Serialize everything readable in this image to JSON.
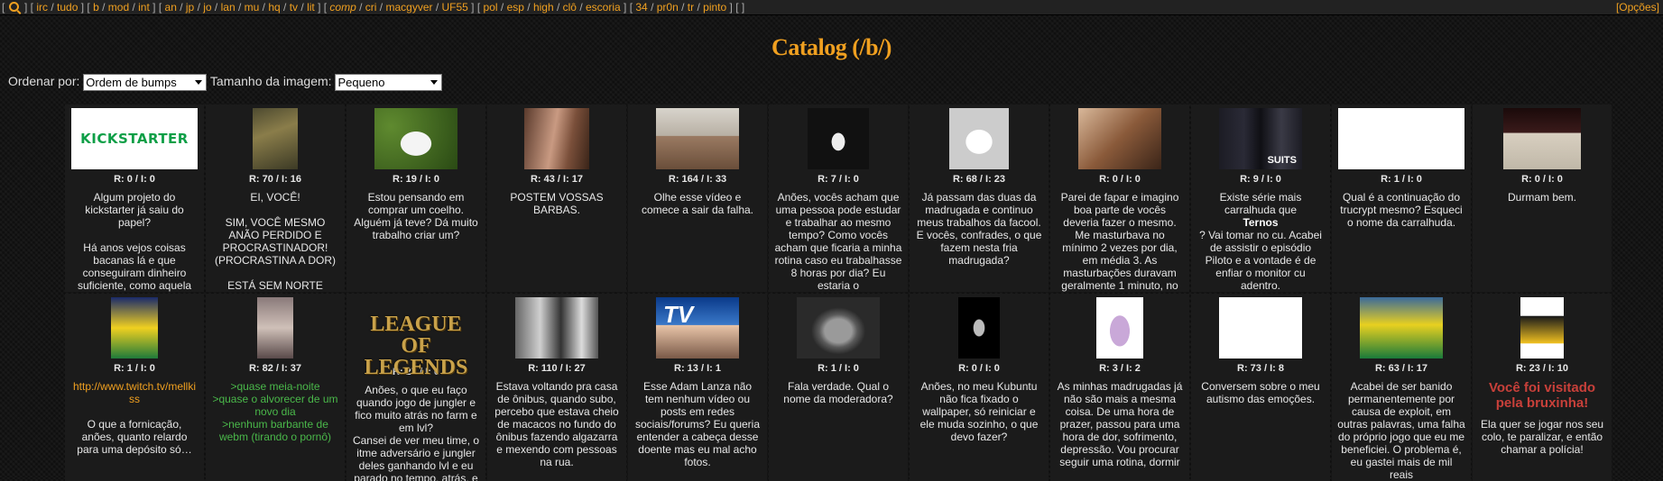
{
  "nav": {
    "groups": [
      [
        "irc",
        "tudo"
      ],
      [
        "b",
        "mod",
        "int"
      ],
      [
        "an",
        "jp",
        "jo",
        "lan",
        "mu",
        "hq",
        "tv",
        "lit"
      ],
      [
        "comp",
        "cri",
        "macgyver",
        "UF55"
      ],
      [
        "pol",
        "esp",
        "high",
        "clô",
        "escoria"
      ],
      [
        "34",
        "pr0n",
        "tr",
        "pinto"
      ],
      []
    ],
    "options_label": "[Opções]"
  },
  "page": {
    "title": "Catalog (/b/)"
  },
  "controls": {
    "sort_label": "Ordenar por:",
    "sort_value": "Ordem de bumps",
    "size_label": "Tamanho da imagem:",
    "size_value": "Pequeno"
  },
  "threads": [
    {
      "meta": "R: 0 / I: 0",
      "text": "Algum projeto do kickstarter já saiu do papel?\n\nHá anos vejos coisas bacanas lá e que conseguiram dinheiro suficiente, como aquela",
      "thumb_text": "KICKSTARTER"
    },
    {
      "meta": "R: 70 / I: 16",
      "text": "EI, VOCÊ!\n\nSIM, VOCÊ MESMO ANÃO PERDIDO E PROCRASTINADOR! (PROCRASTINA A DOR)\n\nESTÁ SEM NORTE"
    },
    {
      "meta": "R: 19 / I: 0",
      "text": "Estou pensando em comprar um coelho. Alguém já teve? Dá muito trabalho criar um?"
    },
    {
      "meta": "R: 43 / I: 17",
      "text": "POSTEM VOSSAS BARBAS."
    },
    {
      "meta": "R: 164 / I: 33",
      "text": "Olhe esse vídeo e comece a sair da falha."
    },
    {
      "meta": "R: 7 / I: 0",
      "text": "Anões, vocês acham que uma pessoa pode estudar e trabalhar ao mesmo tempo? Como vocês acham que ficaria a minha rotina caso eu trabalhasse 8 horas por dia? Eu estaria o"
    },
    {
      "meta": "R: 68 / I: 23",
      "text": "Já passam das duas da madrugada e continuo meus trabalhos da facool. E vocês, confrades, o que fazem nesta fria madrugada?"
    },
    {
      "meta": "R: 0 / I: 0",
      "text": "Parei de fapar e imagino boa parte de vocês deveria fazer o mesmo. Me masturbava no mínimo 2 vezes por dia, em média 3. As masturbações duravam geralmente 1 minuto, no"
    },
    {
      "meta": "R: 9 / I: 0",
      "text_before": "Existe série mais carralhuda que",
      "bold": "Ternos",
      "text_after": "? Vai tomar no cu. Acabei de assistir o episódio Piloto e a vontade é de enfiar o monitor cu adentro.",
      "thumb_text": "SUITS"
    },
    {
      "meta": "R: 1 / I: 0",
      "text": "Qual é a continuação do trucrypt mesmo? Esqueci o nome da carralhuda."
    },
    {
      "meta": "R: 0 / I: 0",
      "text": "Durmam bem."
    },
    {
      "meta": "R: 1 / I: 0",
      "link": "http://www.twitch.tv/mellkiss",
      "text": "O que a fornicação, anões, quanto relardo para uma depósito só…"
    },
    {
      "meta": "R: 82 / I: 37",
      "green": ">quase meia-noite\n>quase o alvorecer de um novo dia\n>nenhum barbante de webm (tirando o pornô)"
    },
    {
      "meta": "R: 27 / I: 0",
      "text": "Anões, o que eu faço quando jogo de jungler e fico muito atrás no farm e em lvl?\nCansei de ver meu time, o itme adversário e jungler deles ganhando lvl e eu parado no tempo, atrás, e",
      "thumb_text": "LEAGUE OF LEGENDS"
    },
    {
      "meta": "R: 110 / I: 27",
      "text": "Estava voltando pra casa de ônibus, quando subo, percebo que estava cheio de macacos no fundo do ônibus fazendo algazarra e mexendo com pessoas na rua."
    },
    {
      "meta": "R: 13 / I: 1",
      "text": "Esse Adam Lanza não tem nenhum vídeo ou posts em redes sociais/forums? Eu queria entender a cabeça desse doente mas eu mal acho fotos.",
      "thumb_text": "TV"
    },
    {
      "meta": "R: 1 / I: 0",
      "text": "Fala verdade. Qual o nome da moderadora?"
    },
    {
      "meta": "R: 0 / I: 0",
      "text": "Anões, no meu Kubuntu não fica fixado o wallpaper, só reiniciar e ele muda sozinho, o que devo fazer?"
    },
    {
      "meta": "R: 3 / I: 2",
      "text": "As minhas madrugadas já não são mais a mesma coisa. De uma hora de prazer, passou para uma hora de dor, sofrimento, depressão. Vou procurar seguir uma rotina, dormir"
    },
    {
      "meta": "R: 73 / I: 8",
      "text": "Conversem sobre o meu autismo das emoções."
    },
    {
      "meta": "R: 63 / I: 17",
      "text": "Acabei de ser banido permanentemente por causa de exploit, em outras palavras, uma falha do próprio jogo que eu me beneficiei. O problema é, eu gastei mais de mil reais"
    },
    {
      "meta": "R: 23 / I: 10",
      "red": "Você foi visitado pela bruxinha!",
      "text": "Ela quer se jogar nos seu colo, te paralizar, e então chamar a polícia!"
    }
  ]
}
